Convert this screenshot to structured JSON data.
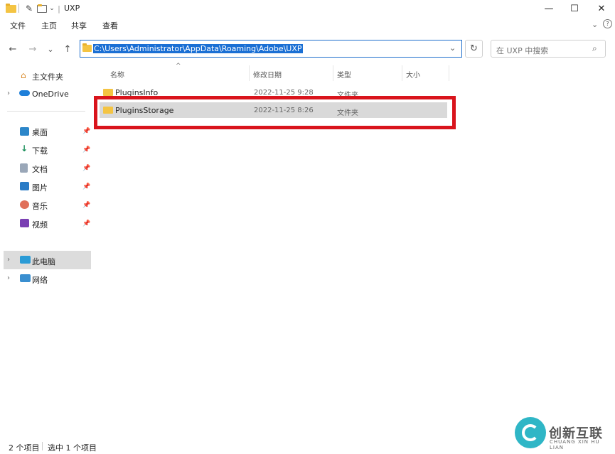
{
  "window": {
    "title": "UXP",
    "minimize": "—",
    "maximize": "☐",
    "close": "✕"
  },
  "menu": {
    "file": "文件",
    "home": "主页",
    "share": "共享",
    "view": "查看"
  },
  "nav": {
    "back": "←",
    "forward": "→",
    "recent": "⌄",
    "up": "↑",
    "address": "C:\\Users\\Administrator\\AppData\\Roaming\\Adobe\\UXP",
    "refresh": "↻",
    "search_placeholder": "在 UXP 中搜索"
  },
  "sidebar": {
    "home": "主文件夹",
    "onedrive": "OneDrive",
    "quick": [
      "桌面",
      "下载",
      "文档",
      "图片",
      "音乐",
      "视频"
    ],
    "pc": "此电脑",
    "network": "网络"
  },
  "columns": {
    "name": "名称",
    "modified": "修改日期",
    "type": "类型",
    "size": "大小"
  },
  "rows": [
    {
      "name": "PluginsInfo",
      "modified": "2022-11-25 9:28",
      "type": "文件夹"
    },
    {
      "name": "PluginsStorage",
      "modified": "2022-11-25 8:26",
      "type": "文件夹"
    }
  ],
  "status": {
    "count": "2 个项目",
    "selected": "选中 1 个项目"
  },
  "watermark": {
    "brand": "创新互联",
    "sub": "CHUANG XIN HU LIAN"
  },
  "colors": {
    "accent": "#1a6fd4",
    "highlight_box": "#d9141c",
    "folder": "#f4c443"
  }
}
